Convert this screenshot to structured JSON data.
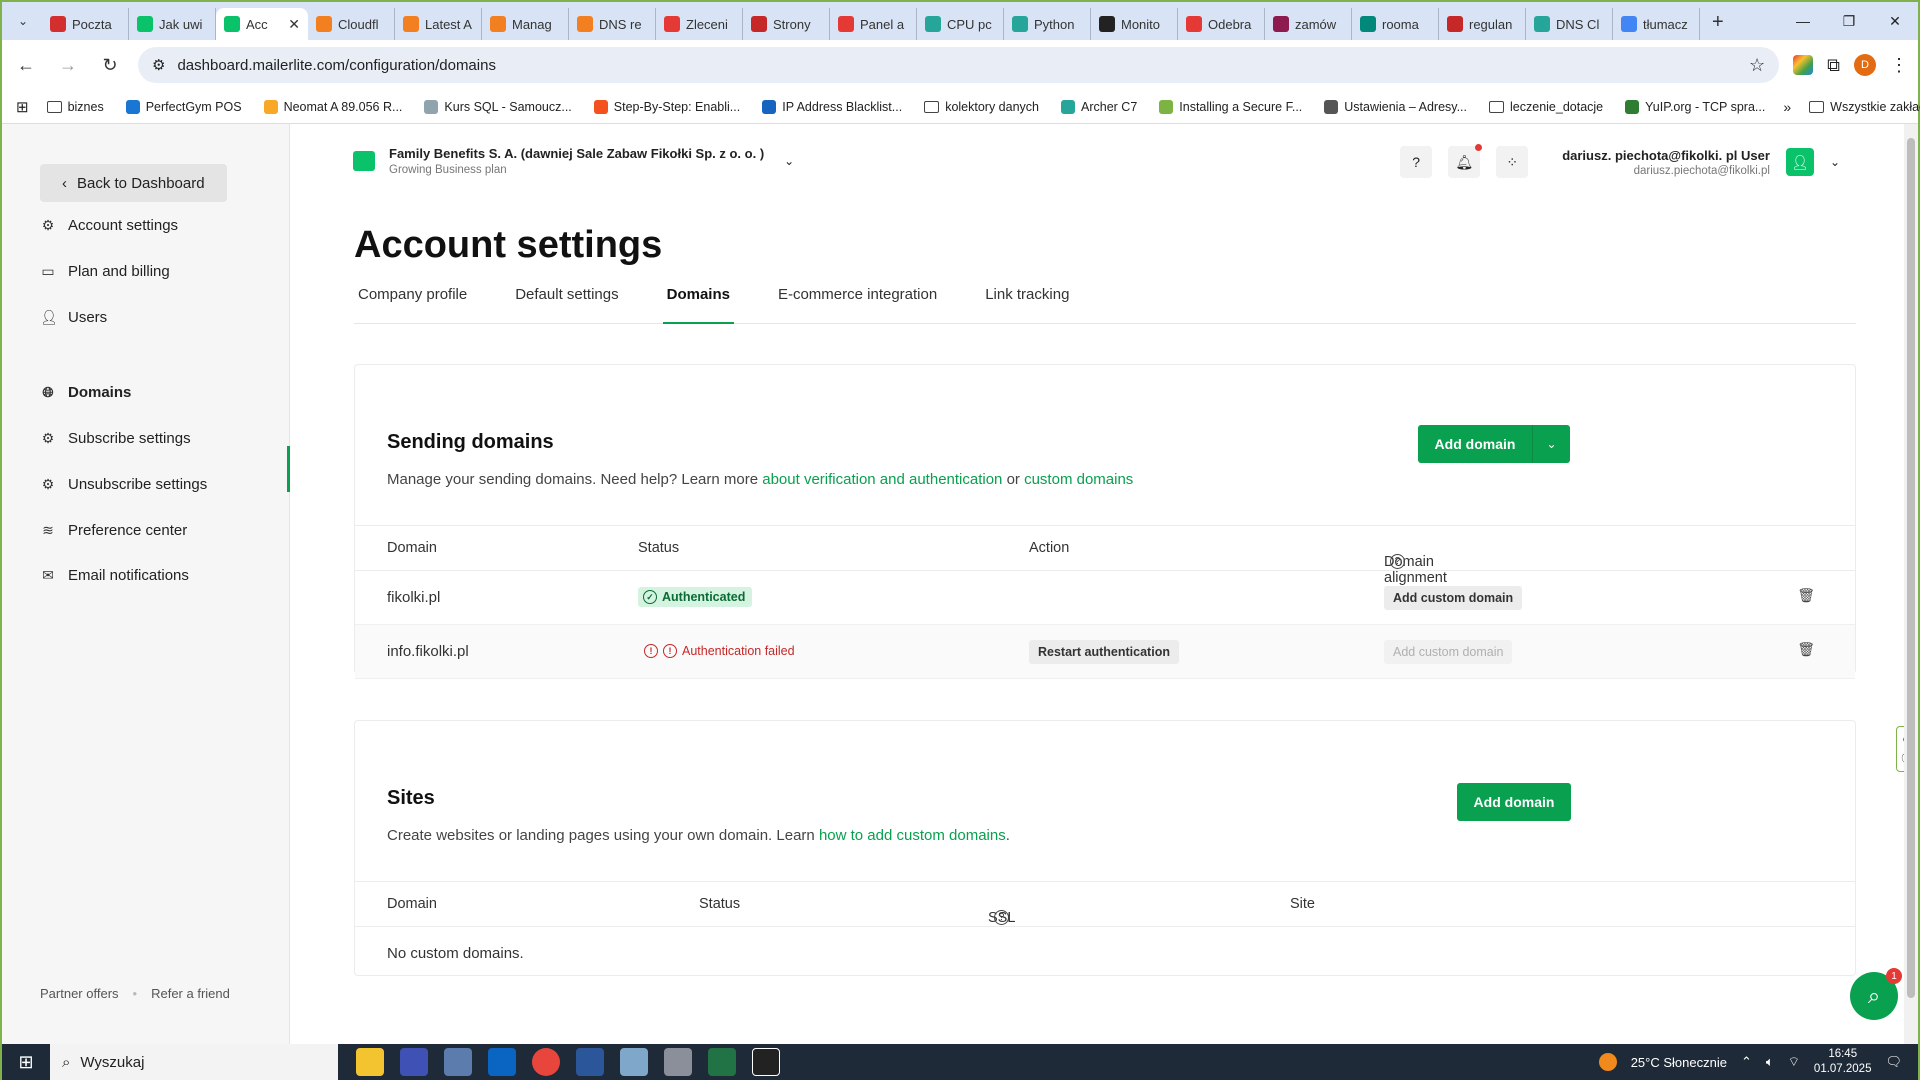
{
  "browser": {
    "tabs": [
      {
        "label": "Poczta",
        "color": "#d32f2f"
      },
      {
        "label": "Jak uwi",
        "color": "#09c269"
      },
      {
        "label": "Acc",
        "color": "#09c269",
        "active": true
      },
      {
        "label": "Cloudfl",
        "color": "#f38020"
      },
      {
        "label": "Latest A",
        "color": "#f38020"
      },
      {
        "label": "Manag",
        "color": "#f38020"
      },
      {
        "label": "DNS re",
        "color": "#f38020"
      },
      {
        "label": "Zleceni",
        "color": "#e53935"
      },
      {
        "label": "Strony",
        "color": "#c62828"
      },
      {
        "label": "Panel a",
        "color": "#e53935"
      },
      {
        "label": "CPU pc",
        "color": "#26a69a"
      },
      {
        "label": "Python",
        "color": "#26a69a"
      },
      {
        "label": "Monito",
        "color": "#222222"
      },
      {
        "label": "Odebra",
        "color": "#e53935"
      },
      {
        "label": "zamów",
        "color": "#8e1b4f"
      },
      {
        "label": "rooma",
        "color": "#00897b"
      },
      {
        "label": "regulan",
        "color": "#c62828"
      },
      {
        "label": "DNS Cl",
        "color": "#26a69a"
      },
      {
        "label": "tłumacz",
        "color": "#4285f4"
      }
    ],
    "url": "dashboard.mailerlite.com/configuration/domains",
    "profile_initial": "D"
  },
  "bookmarks": [
    {
      "label": "biznes",
      "type": "folder"
    },
    {
      "label": "PerfectGym POS",
      "color": "#1976d2"
    },
    {
      "label": "Neomat A 89.056 R...",
      "color": "#f9a825"
    },
    {
      "label": "Kurs SQL - Samoucz...",
      "color": "#90a4ae"
    },
    {
      "label": "Step-By-Step: Enabli...",
      "color": "#f4511e"
    },
    {
      "label": "IP Address Blacklist...",
      "color": "#1565c0"
    },
    {
      "label": "kolektory danych",
      "type": "folder"
    },
    {
      "label": "Archer C7",
      "color": "#26a69a"
    },
    {
      "label": "Installing a Secure F...",
      "color": "#7cb342"
    },
    {
      "label": "Ustawienia – Adresy...",
      "color": "#555555"
    },
    {
      "label": "leczenie_dotacje",
      "type": "folder"
    },
    {
      "label": "YuIP.org - TCP spra...",
      "color": "#2e7d32"
    }
  ],
  "bookmarks_other": "Wszystkie zakładki",
  "sidebar": {
    "back_label": "Back to Dashboard",
    "items": [
      {
        "label": "Account settings",
        "icon": "gear-icon"
      },
      {
        "label": "Plan and billing",
        "icon": "card-icon"
      },
      {
        "label": "Users",
        "icon": "user-icon"
      },
      {
        "label": "Domains",
        "icon": "globe-icon",
        "active": true
      },
      {
        "label": "Subscribe settings",
        "icon": "gear-icon"
      },
      {
        "label": "Unsubscribe settings",
        "icon": "gear-icon"
      },
      {
        "label": "Preference center",
        "icon": "layers-icon"
      },
      {
        "label": "Email notifications",
        "icon": "mail-icon"
      }
    ],
    "footer": {
      "partner": "Partner offers",
      "refer": "Refer a friend"
    }
  },
  "account": {
    "name": "Family Benefits S. A. (dawniej Sale Zabaw Fikołki Sp. z o. o. )",
    "plan": "Growing Business plan"
  },
  "user": {
    "name": "dariusz. piechota@fikolki. pl User",
    "email": "dariusz.piechota@fikolki.pl"
  },
  "page": {
    "title": "Account settings",
    "tabs": [
      "Company profile",
      "Default settings",
      "Domains",
      "E-commerce integration",
      "Link tracking"
    ],
    "active_tab": "Domains"
  },
  "sending": {
    "title": "Sending domains",
    "desc_prefix": "Manage your sending domains. Need help? Learn more ",
    "link1": "about verification and authentication",
    "desc_mid": " or ",
    "link2": "custom domains",
    "add_label": "Add domain",
    "columns": [
      "Domain",
      "Status",
      "Action",
      "Domain alignment"
    ],
    "rows": [
      {
        "domain": "fikolki.pl",
        "status": "Authenticated",
        "status_type": "ok",
        "action": "",
        "alignment": "Add custom domain",
        "alignment_enabled": true
      },
      {
        "domain": "info.fikolki.pl",
        "status": "Authentication failed",
        "status_type": "fail",
        "action": "Restart authentication",
        "alignment": "Add custom domain",
        "alignment_enabled": false
      }
    ]
  },
  "sites": {
    "title": "Sites",
    "desc_prefix": "Create websites or landing pages using your own domain. Learn ",
    "link": "how to add custom domains",
    "desc_suffix": ".",
    "add_label": "Add domain",
    "columns": [
      "Domain",
      "Status",
      "SSL",
      "Site"
    ],
    "empty": "No custom domains."
  },
  "chat": {
    "badge": "1"
  },
  "taskbar": {
    "search": "Wyszukaj",
    "weather": "25°C  Słonecznie",
    "time": "16:45",
    "date": "01.07.2025"
  },
  "colors": {
    "accent": "#09a04f",
    "error": "#c62828",
    "ok_bg": "#d4f3e0"
  }
}
